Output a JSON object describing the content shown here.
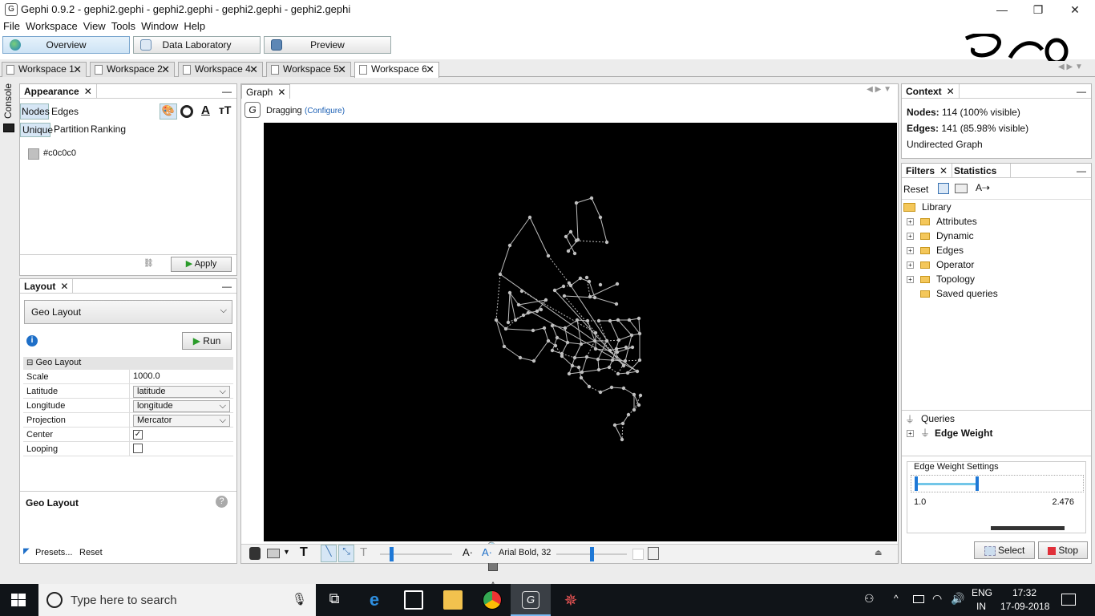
{
  "window": {
    "title": "Gephi 0.9.2 - gephi2.gephi - gephi2.gephi - gephi2.gephi - gephi2.gephi",
    "minimize": "—",
    "maximize": "❐",
    "close": "✕"
  },
  "menu": [
    "File",
    "Workspace",
    "View",
    "Tools",
    "Window",
    "Help"
  ],
  "modes": {
    "overview": "Overview",
    "data_lab": "Data Laboratory",
    "preview": "Preview"
  },
  "workspaces": [
    "Workspace 1",
    "Workspace 2",
    "Workspace 4",
    "Workspace 5",
    "Workspace 6"
  ],
  "side": {
    "console": "Console"
  },
  "appearance": {
    "title": "Appearance",
    "tabs": {
      "nodes": "Nodes",
      "edges": "Edges"
    },
    "subtabs": {
      "unique": "Unique",
      "partition": "Partition",
      "ranking": "Ranking"
    },
    "color_value": "#c0c0c0",
    "apply": "Apply",
    "color_hex": "#c0c0c0"
  },
  "layout": {
    "title": "Layout",
    "selected": "Geo Layout",
    "run": "Run",
    "section": "Geo Layout",
    "props": [
      {
        "key": "Scale",
        "value": "1000.0"
      },
      {
        "key": "Latitude",
        "value": "latitude"
      },
      {
        "key": "Longitude",
        "value": "longitude"
      },
      {
        "key": "Projection",
        "value": "Mercator"
      },
      {
        "key": "Center",
        "value": ""
      },
      {
        "key": "Looping",
        "value": ""
      }
    ],
    "center_checked": true,
    "looping_checked": false,
    "desc_title": "Geo Layout",
    "presets": "Presets...",
    "reset": "Reset"
  },
  "graph": {
    "tab": "Graph",
    "mode": "Dragging",
    "configure": "(Configure)",
    "font": "Arial Bold, 32"
  },
  "context": {
    "title": "Context",
    "nodes_label": "Nodes:",
    "nodes_value": "114 (100% visible)",
    "edges_label": "Edges:",
    "edges_value": "141 (85.98% visible)",
    "type": "Undirected Graph"
  },
  "filters": {
    "tab_filters": "Filters",
    "tab_statistics": "Statistics",
    "reset": "Reset",
    "library": "Library",
    "items": [
      "Attributes",
      "Dynamic",
      "Edges",
      "Operator",
      "Topology",
      "Saved queries"
    ],
    "queries": "Queries",
    "query_item": "Edge Weight",
    "settings_title": "Edge Weight Settings",
    "range_min": "1.0",
    "range_max": "2.476",
    "select": "Select",
    "stop": "Stop"
  },
  "taskbar": {
    "search_placeholder": "Type here to search",
    "lang_top": "ENG",
    "lang_bottom": "IN",
    "time": "17:32",
    "date": "17-09-2018"
  }
}
